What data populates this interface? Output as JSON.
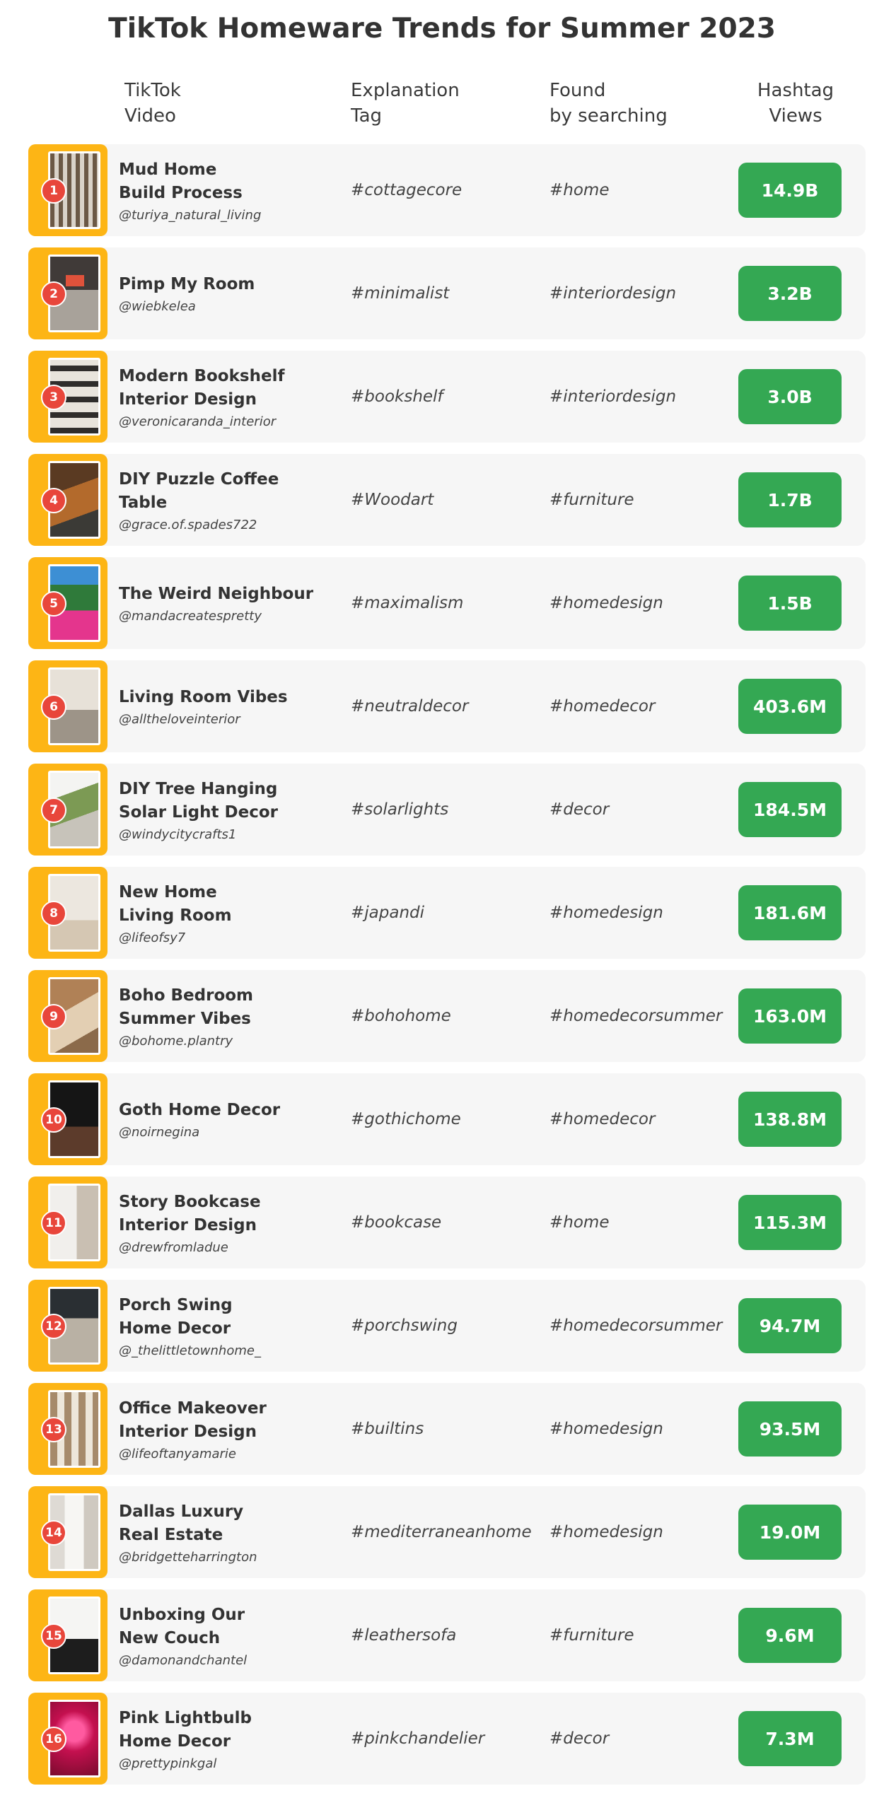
{
  "title": "TikTok Homeware Trends for Summer 2023",
  "headers": {
    "video": "TikTok\nVideo",
    "tag": "Explanation\nTag",
    "found": "Found\nby searching",
    "views": "Hashtag\nViews"
  },
  "colors": {
    "thumb_frame": "#fdb515",
    "rank_badge": "#e8463b",
    "views_badge": "#34a853",
    "row_bg": "#f6f6f6"
  },
  "rows": [
    {
      "rank": "1",
      "title": "Mud Home\nBuild Process",
      "handle": "@turiya_natural_living",
      "tag": "#cottagecore",
      "found": "#home",
      "views": "14.9B"
    },
    {
      "rank": "2",
      "title": "Pimp My Room",
      "handle": "@wiebkelea",
      "tag": "#minimalist",
      "found": "#interiordesign",
      "views": "3.2B"
    },
    {
      "rank": "3",
      "title": "Modern Bookshelf\nInterior Design",
      "handle": "@veronicaranda_interior",
      "tag": "#bookshelf",
      "found": "#interiordesign",
      "views": "3.0B"
    },
    {
      "rank": "4",
      "title": "DIY Puzzle Coffee Table",
      "handle": "@grace.of.spades722",
      "tag": "#Woodart",
      "found": "#furniture",
      "views": "1.7B"
    },
    {
      "rank": "5",
      "title": "The Weird Neighbour",
      "handle": "@mandacreatespretty",
      "tag": "#maximalism",
      "found": "#homedesign",
      "views": "1.5B"
    },
    {
      "rank": "6",
      "title": "Living Room Vibes",
      "handle": "@alltheloveinterior",
      "tag": "#neutraldecor",
      "found": "#homedecor",
      "views": "403.6M"
    },
    {
      "rank": "7",
      "title": "DIY Tree Hanging\nSolar Light Decor",
      "handle": "@windycitycrafts1",
      "tag": "#solarlights",
      "found": "#decor",
      "views": "184.5M"
    },
    {
      "rank": "8",
      "title": "New Home\nLiving Room",
      "handle": "@lifeofsy7",
      "tag": "#japandi",
      "found": "#homedesign",
      "views": "181.6M"
    },
    {
      "rank": "9",
      "title": "Boho Bedroom\nSummer Vibes",
      "handle": "@bohome.plantry",
      "tag": "#bohohome",
      "found": "#homedecorsummer",
      "views": "163.0M"
    },
    {
      "rank": "10",
      "title": "Goth Home Decor",
      "handle": "@noirnegina",
      "tag": "#gothichome",
      "found": "#homedecor",
      "views": "138.8M"
    },
    {
      "rank": "11",
      "title": "Story Bookcase\nInterior Design",
      "handle": "@drewfromladue",
      "tag": "#bookcase",
      "found": "#home",
      "views": "115.3M"
    },
    {
      "rank": "12",
      "title": "Porch Swing\nHome Decor",
      "handle": "@_thelittletownhome_",
      "tag": "#porchswing",
      "found": "#homedecorsummer",
      "views": "94.7M"
    },
    {
      "rank": "13",
      "title": "Office Makeover\nInterior Design",
      "handle": "@lifeoftanyamarie",
      "tag": "#builtins",
      "found": "#homedesign",
      "views": "93.5M"
    },
    {
      "rank": "14",
      "title": "Dallas Luxury\nReal Estate",
      "handle": "@bridgetteharrington",
      "tag": "#mediterraneanhome",
      "found": "#homedesign",
      "views": "19.0M"
    },
    {
      "rank": "15",
      "title": "Unboxing Our\nNew Couch",
      "handle": "@damonandchantel",
      "tag": "#leathersofa",
      "found": "#furniture",
      "views": "9.6M"
    },
    {
      "rank": "16",
      "title": "Pink Lightbulb\nHome Decor",
      "handle": "@prettypinkgal",
      "tag": "#pinkchandelier",
      "found": "#decor",
      "views": "7.3M"
    }
  ]
}
